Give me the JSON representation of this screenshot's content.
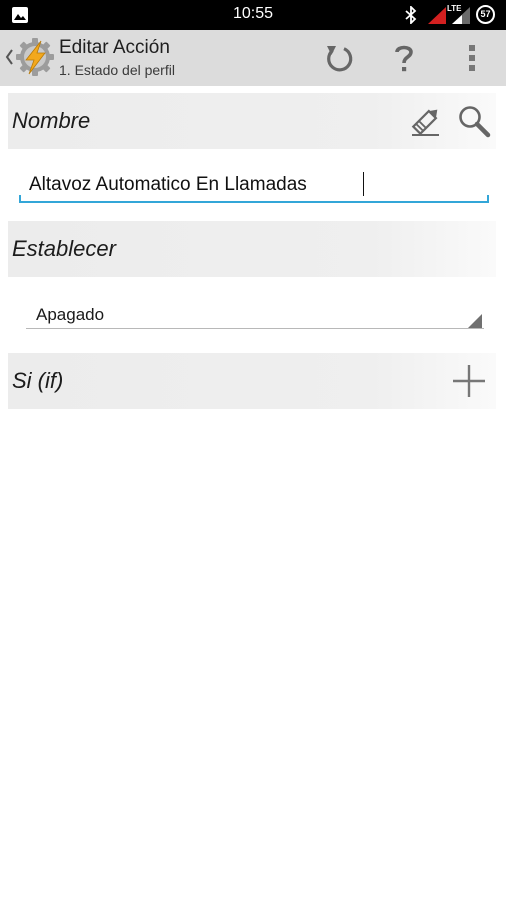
{
  "status_bar": {
    "time": "10:55",
    "network_label": "LTE",
    "battery_level": "57",
    "icons": [
      "gallery-icon",
      "bluetooth-icon",
      "signal-icon",
      "signal-icon",
      "battery-icon"
    ]
  },
  "action_bar": {
    "title": "Editar Acción",
    "subtitle": "1. Estado del perfil",
    "icons": [
      "back-icon",
      "app-icon",
      "undo-icon",
      "help-icon",
      "more-vert-icon"
    ]
  },
  "nombre": {
    "label": "Nombre",
    "value": "Altavoz Automatico En Llamadas",
    "icons": [
      "edit-icon",
      "search-icon"
    ]
  },
  "establecer": {
    "label": "Establecer",
    "selected": "Apagado"
  },
  "si": {
    "label": "Si (if)",
    "icons": [
      "add-icon"
    ]
  },
  "colors": {
    "accent": "#33a6d8",
    "action_bar_bg": "#dcdcdc",
    "section_bg": "#ececec",
    "app_icon": "#f2a81d"
  }
}
